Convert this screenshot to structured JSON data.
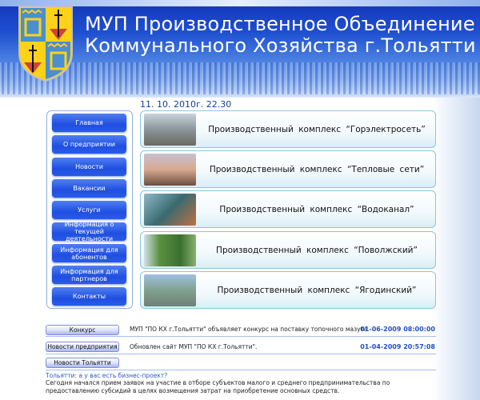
{
  "header": {
    "title_line1": "МУП Производственное Объединение",
    "title_line2": "Коммунального Хозяйства г.Тольятти",
    "datetime": "11. 10. 2010г.  22.30"
  },
  "menu": [
    {
      "label": "Главная"
    },
    {
      "label": "О предприятии"
    },
    {
      "label": "Новости"
    },
    {
      "label": "Вакансии"
    },
    {
      "label": "Услуги"
    },
    {
      "label": "Информация  о текущей деятельности"
    },
    {
      "label": "Информация для абонентов"
    },
    {
      "label": "Информация для партнеров"
    },
    {
      "label": "Контакты"
    }
  ],
  "complexes": [
    {
      "label": "Производственный  комплекс “Горэлектросеть”"
    },
    {
      "label": "Производственный  комплекс “Тепловые  сети”"
    },
    {
      "label": "Производственный  комплекс  “Водоканал”"
    },
    {
      "label": "Производственный  комплекс  “Поволжский”"
    },
    {
      "label": "Производственный  комплекс  “Ягодинский”"
    }
  ],
  "news": [
    {
      "category": "Конкурс",
      "text": "МУП \"ПО КХ г.Тольятти\" объявляет конкурс на поставку топочного мазута",
      "date": "01-06-2009 08:00:00"
    },
    {
      "category": "Новости предприятия",
      "text": "Обновлен сайт МУП \"ПО КХ г.Тольятти\".",
      "date": "01-04-2009 20:57:08"
    },
    {
      "category": "Новости Тольятти"
    }
  ],
  "city_news": {
    "link": "Тольятти: а у вас есть бизнес-проект?",
    "text": "Сегодня начался прием заявок на участие в отборе субъектов малого и среднего предпринимательства по предоставлению субсидий в целях возмещения затрат на приобретение основных средств."
  },
  "colors": {
    "header_blue": "#1e4fd0",
    "menu_button": "#2a5ae8",
    "date_blue": "#2050c0"
  }
}
